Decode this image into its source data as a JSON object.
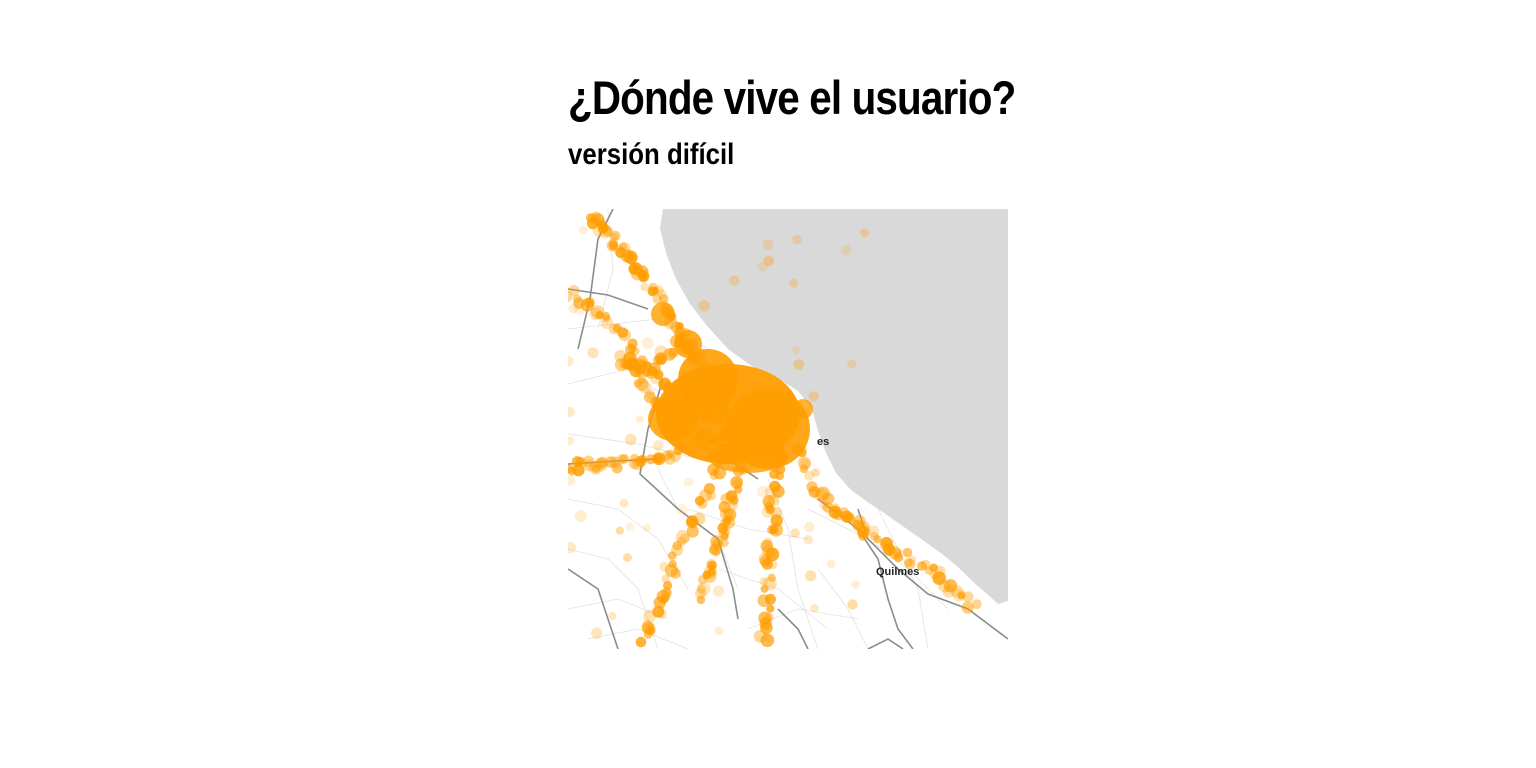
{
  "page": {
    "title": "¿Dónde vive el usuario?",
    "subtitle": "versión difícil"
  },
  "map": {
    "labels": {
      "quilmes": "Quilmes",
      "cut_label": "es"
    },
    "colors": {
      "water": "#d9d9d9",
      "land": "#ffffff",
      "points": "#ff9d00",
      "roads": "#8c8c8c"
    }
  }
}
